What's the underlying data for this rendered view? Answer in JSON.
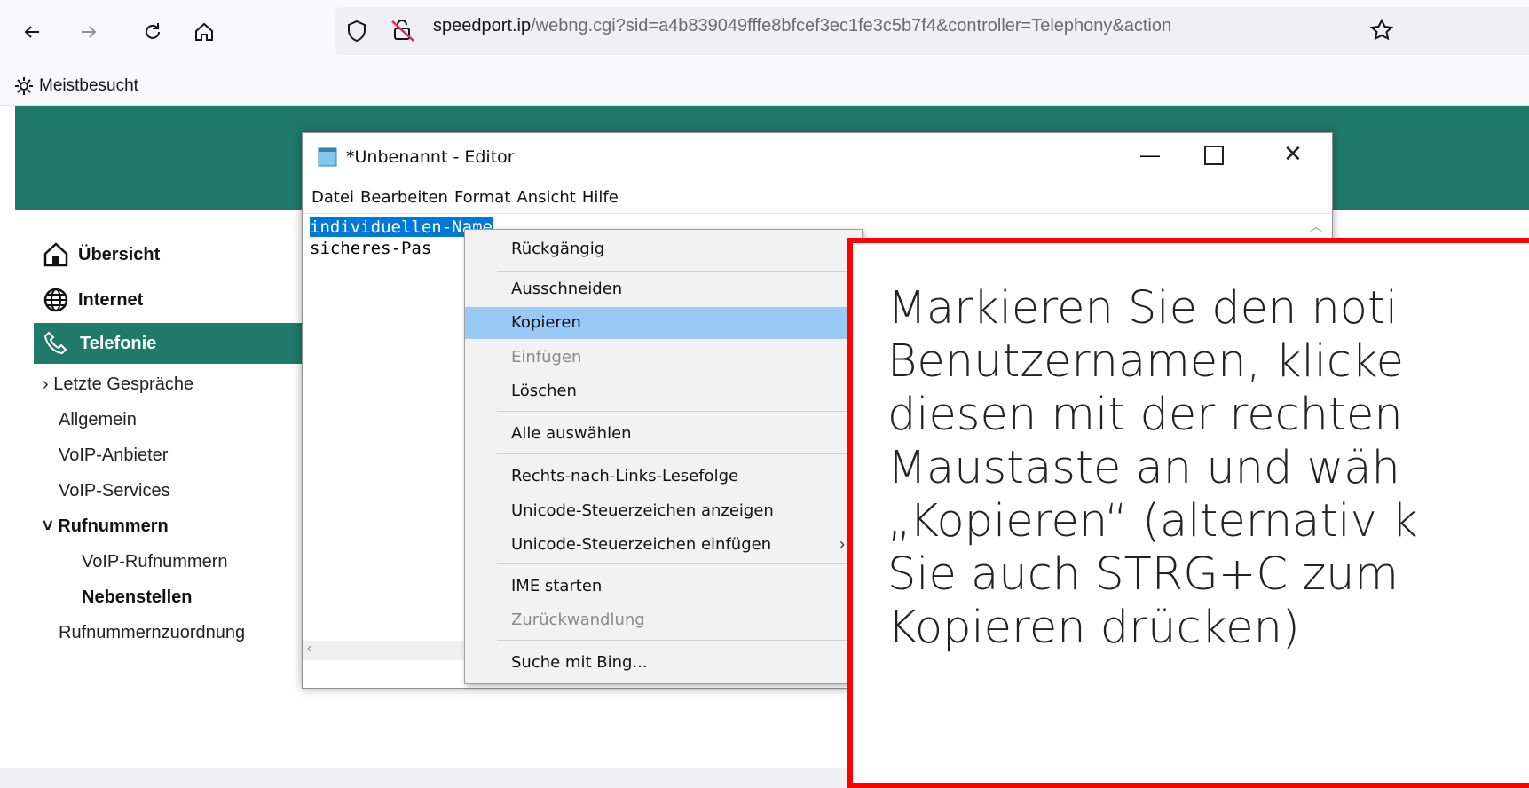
{
  "browser": {
    "url_host": "speedport.ip",
    "url_rest": "/webng.cgi?sid=a4b839049fffe8bfcef3ec1fe3c5b7f4&controller=Telephony&action",
    "bookmarks_label": "Meistbesucht"
  },
  "nav": {
    "uebersicht": "Übersicht",
    "internet": "Internet",
    "telefonie": "Telefonie",
    "items": [
      "Letzte Gespräche",
      "Allgemein",
      "VoIP-Anbieter",
      "VoIP-Services",
      "Rufnummern",
      "VoIP-Rufnummern",
      "Nebenstellen",
      "Rufnummernzuordnung"
    ]
  },
  "notepad": {
    "title": "*Unbenannt - Editor",
    "menu": [
      "Datei",
      "Bearbeiten",
      "Format",
      "Ansicht",
      "Hilfe"
    ],
    "line1_selected": "individuellen-Name",
    "line2": "sicheres-Pas"
  },
  "context_menu": {
    "items": [
      "Rückgängig",
      "Ausschneiden",
      "Kopieren",
      "Einfügen",
      "Löschen",
      "Alle auswählen",
      "Rechts-nach-Links-Lesefolge",
      "Unicode-Steuerzeichen anzeigen",
      "Unicode-Steuerzeichen einfügen",
      "IME starten",
      "Zurückwandlung",
      "Suche mit Bing..."
    ]
  },
  "callout": {
    "lines": [
      "Markieren Sie den noti",
      "Benutzernamen, klicke",
      "diesen mit der rechten",
      "Maustaste an und wäh",
      "„Kopieren“ (alternativ k",
      "Sie auch STRG+C zum",
      "Kopieren drücken)"
    ]
  }
}
